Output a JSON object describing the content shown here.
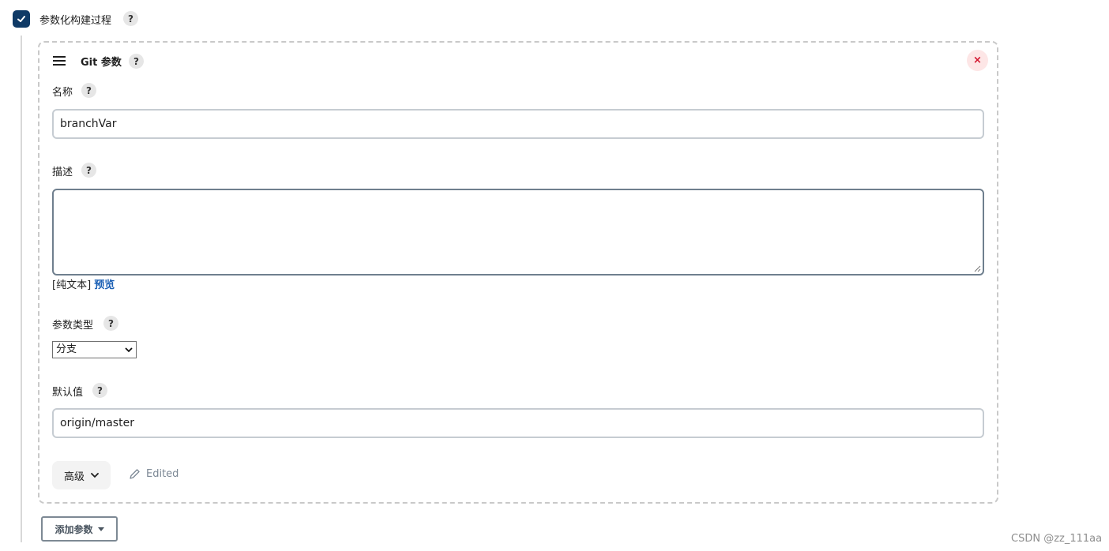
{
  "section": {
    "checkbox_label": "参数化构建过程",
    "help": "?"
  },
  "param": {
    "title": "Git 参数",
    "help": "?",
    "close_symbol": "×",
    "name_label": "名称",
    "name_value": "branchVar",
    "desc_label": "描述",
    "desc_value": "",
    "format_text": "[纯文本]",
    "preview_link": "预览",
    "type_label": "参数类型",
    "type_selected": "分支",
    "default_label": "默认值",
    "default_value": "origin/master",
    "advanced_label": "高级",
    "edited_label": "Edited"
  },
  "add_param_label": "添加参数",
  "watermark": "CSDN @zz_111aa",
  "icons": {
    "checkbox": "check-icon",
    "drag": "drag-handle-icon",
    "close": "close-icon",
    "advanced": "chevron-down-icon",
    "edited": "pencil-icon",
    "add": "caret-down-icon"
  },
  "colors": {
    "checkbox_bg": "#0f3a66",
    "close_bg": "#fde6e6",
    "close_fg": "#d3112a",
    "link": "#1a5fb4"
  }
}
